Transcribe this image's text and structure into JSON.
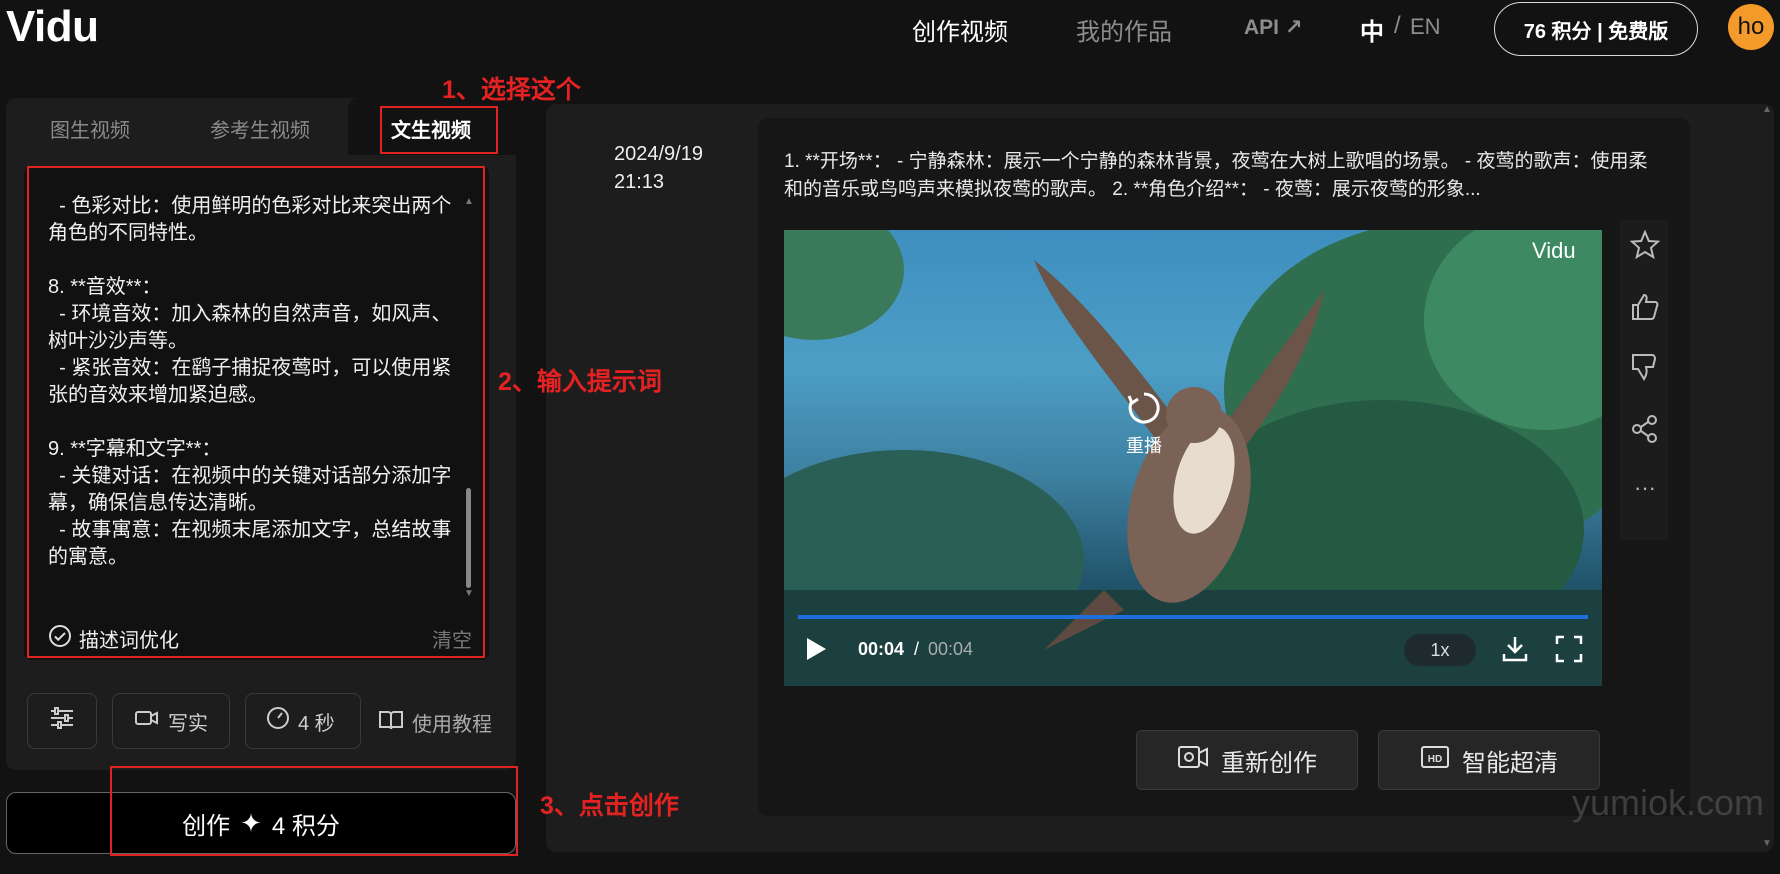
{
  "header": {
    "logo": "Vidu",
    "nav": [
      "创作视频",
      "我的作品",
      "API ↗"
    ],
    "lang_zh": "中",
    "lang_sep": "/",
    "lang_en": "EN",
    "credits": "76 积分 | 免费版",
    "avatar": "ho"
  },
  "left": {
    "tabs": [
      "图生视频",
      "参考生视频",
      "文生视频"
    ],
    "prompt": "  - 色彩对比：使用鲜明的色彩对比来突出两个角色的不同特性。\n\n8. **音效**：\n  - 环境音效：加入森林的自然声音，如风声、树叶沙沙声等。\n  - 紧张音效：在鹞子捕捉夜莺时，可以使用紧张的音效来增加紧迫感。\n\n9. **字幕和文字**：\n  - 关键对话：在视频中的关键对话部分添加字幕，确保信息传达清晰。\n  - 故事寓意：在视频末尾添加文字，总结故事的寓意。",
    "optimize_label": "描述词优化",
    "clear_label": "清空",
    "tools": {
      "style": "写实",
      "duration": "4 秒",
      "tutorial": "使用教程"
    },
    "create_label": "创作",
    "create_cost": "4 积分"
  },
  "annotations": {
    "step1": "1、选择这个",
    "step2": "2、输入提示词",
    "step3": "3、点击创作"
  },
  "result": {
    "date": "2024/9/19",
    "time": "21:13",
    "description": "1. **开场**： - 宁静森林：展示一个宁静的森林背景，夜莺在大树上歌唱的场景。 - 夜莺的歌声：使用柔和的音乐或鸟鸣声来模拟夜莺的歌声。 2. **角色介绍**： - 夜莺：展示夜莺的形象...",
    "video": {
      "watermark": "Vidu",
      "replay_label": "重播",
      "current_time": "00:04",
      "time_sep": "/",
      "total_time": "00:04",
      "speed": "1x",
      "progress": 1.0
    },
    "actions": {
      "recreate": "重新创作",
      "upscale": "智能超清"
    }
  },
  "watermark": "yumiok.com"
}
